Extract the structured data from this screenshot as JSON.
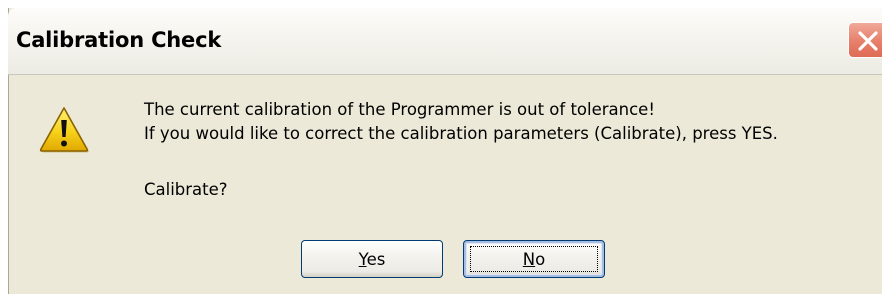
{
  "window": {
    "title": "Calibration Check"
  },
  "message": {
    "line1": "The current calibration of the Programmer is out of tolerance!",
    "line2": "If you would like to correct the calibration parameters (Calibrate), press YES.",
    "question": "Calibrate?"
  },
  "buttons": {
    "yes": {
      "accel": "Y",
      "rest": "es"
    },
    "no": {
      "accel": "N",
      "rest": "o"
    }
  },
  "icons": {
    "warning": "warning-triangle-icon",
    "close": "close-x-icon"
  },
  "colors": {
    "dialog_bg": "#ece9d8",
    "close_button": "#e8826e",
    "warning_yellow": "#f7d21c",
    "button_border": "#003c74"
  }
}
